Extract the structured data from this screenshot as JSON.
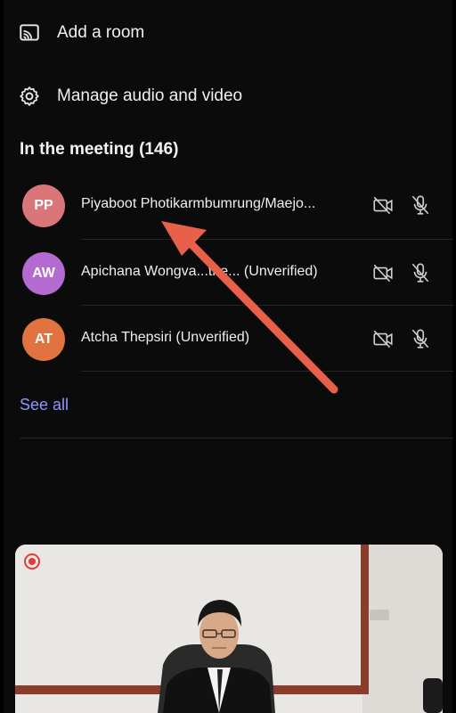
{
  "menu": [
    {
      "label": "Add a room",
      "icon": "cast-room-icon"
    },
    {
      "label": "Manage audio and video",
      "icon": "gear-icon"
    }
  ],
  "meeting": {
    "title": "In the meeting (146)",
    "see_all": "See all"
  },
  "participants": [
    {
      "initials": "PP",
      "name": "Piyaboot Photikarmbumrung/Maejo...",
      "avatar_color": "#d9767a"
    },
    {
      "initials": "AW",
      "name": "Apichana Wongva...the...  (Unverified)",
      "avatar_color": "#b36bd1"
    },
    {
      "initials": "AT",
      "name": "Atcha Thepsiri (Unverified)",
      "avatar_color": "#e0733f"
    }
  ],
  "colors": {
    "accent": "#8f97ff",
    "annotation_arrow": "#e8604a",
    "recording": "#e33b3b"
  }
}
